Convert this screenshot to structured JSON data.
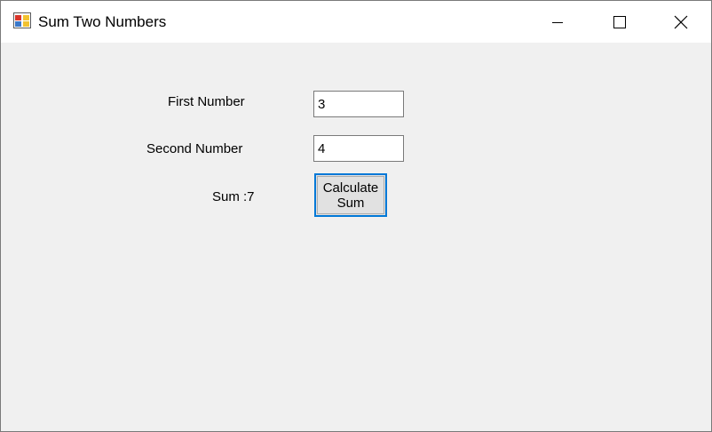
{
  "window": {
    "title": "Sum Two Numbers",
    "icons": {
      "app": "winforms-app-icon",
      "minimize": "minimize-icon",
      "maximize": "maximize-icon",
      "close": "close-icon"
    }
  },
  "form": {
    "first_label": "First Number",
    "first_value": "3",
    "second_label": "Second Number",
    "second_value": "4",
    "sum_label": "Sum :7",
    "calculate_button": "Calculate Sum"
  },
  "colors": {
    "titlebar": "#ffffff",
    "client_background": "#f0f0f0",
    "button_focus_border": "#0078d7",
    "button_face": "#e1e1e1"
  }
}
